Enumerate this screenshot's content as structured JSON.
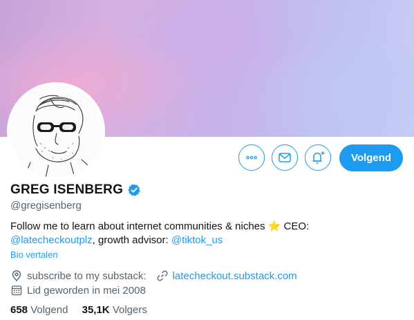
{
  "profile": {
    "name": "GREG ISENBERG",
    "handle": "@gregisenberg",
    "bio": {
      "text1": "Follow me to learn about internet communities & niches ",
      "star": "⭐",
      "text2": " CEO:",
      "link1": "@latecheckoutplz",
      "text3": ", growth advisor: ",
      "link2": "@tiktok_us"
    },
    "translate_label": "Bio vertalen",
    "location": "subscribe to my substack:",
    "website": "latecheckout.substack.com",
    "joined": "Lid geworden in mei 2008",
    "following_count": "658",
    "following_label": "Volgend",
    "followers_count": "35,1K",
    "followers_label": "Volgers"
  },
  "actions": {
    "follow_label": "Volgend",
    "more_icon": "more-icon",
    "message_icon": "envelope-icon",
    "notify_icon": "bell-plus-icon"
  },
  "colors": {
    "accent": "#1d9bf0",
    "text": "#0f1419",
    "secondary": "#536471"
  }
}
